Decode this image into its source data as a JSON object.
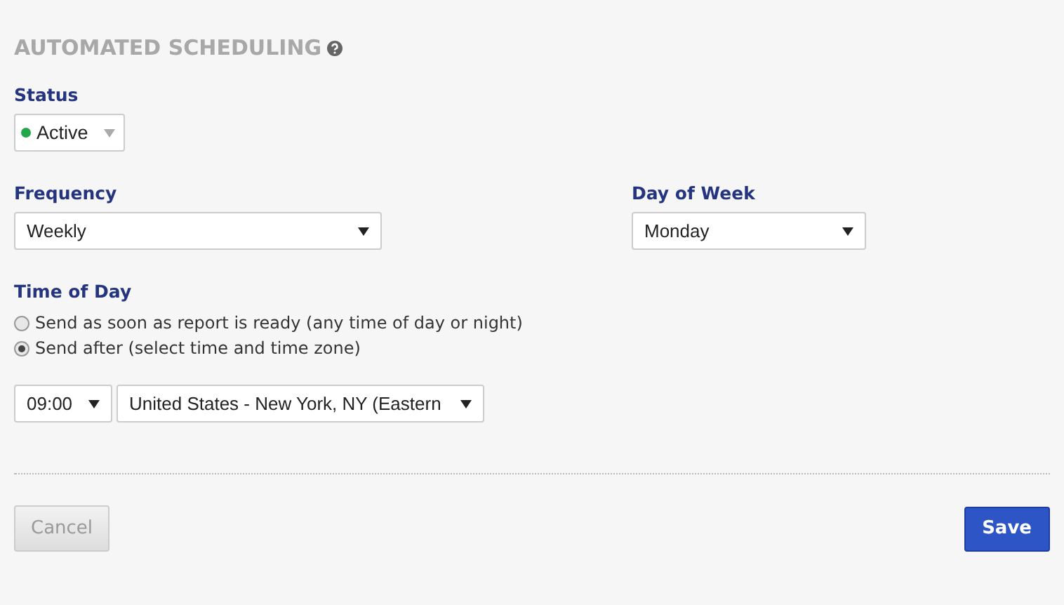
{
  "heading": {
    "title": "AUTOMATED SCHEDULING",
    "help": true
  },
  "status": {
    "label": "Status",
    "value": "Active",
    "color": "#22a84a"
  },
  "frequency": {
    "label": "Frequency",
    "value": "Weekly"
  },
  "day_of_week": {
    "label": "Day of Week",
    "value": "Monday"
  },
  "time_of_day": {
    "label": "Time of Day",
    "options": [
      {
        "label": "Send as soon as report is ready (any time of day or night)",
        "selected": false
      },
      {
        "label": "Send after (select time and time zone)",
        "selected": true
      }
    ],
    "time": "09:00",
    "time_zone": "United States - New York, NY (Eastern"
  },
  "buttons": [
    {
      "kind": "secondary",
      "label": "Cancel",
      "disabled": true
    },
    {
      "kind": "primary",
      "label": "Save",
      "disabled": false
    }
  ]
}
